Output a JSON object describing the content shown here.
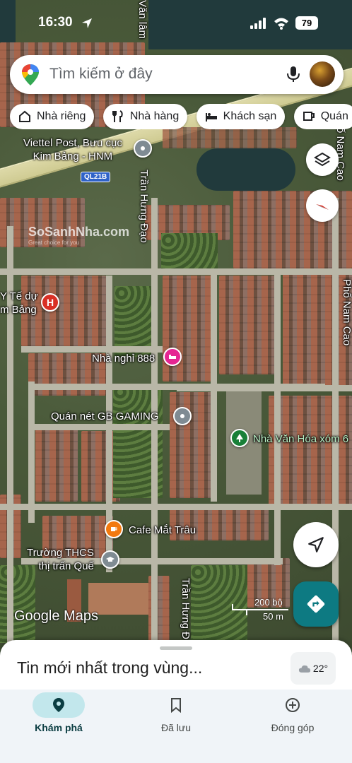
{
  "status_bar": {
    "time": "16:30",
    "battery": "79"
  },
  "search": {
    "placeholder": "Tìm kiếm ở đây"
  },
  "chips": [
    {
      "label": "Nhà riêng",
      "icon": "home-icon"
    },
    {
      "label": "Nhà hàng",
      "icon": "restaurant-icon"
    },
    {
      "label": "Khách sạn",
      "icon": "hotel-icon"
    },
    {
      "label": "Quán",
      "icon": "coffee-icon"
    }
  ],
  "map": {
    "places": {
      "post_office": "Viettel Post, Bưu cục\nKim Bảng - HNM",
      "health": "Y Tế dự\nm Bảng",
      "guesthouse": "Nhà nghỉ 888",
      "gaming": "Quán nét GB GAMING",
      "culture_house": "Nhà Văn Hóa xóm 6",
      "cafe": "Cafe Mắt Trâu",
      "school": "Trường THCS\nthị trấn Quế"
    },
    "streets": {
      "van_lam": "Văn lâm",
      "tran_hung_dao_1": "Trần Hưng Đạo",
      "tran_hung_dao_2": "Trần Hưng Đ",
      "nam_cao_1": "ố Nam Cao",
      "nam_cao_2": "Phố Nam Cao"
    },
    "route_badge": "QL21B",
    "watermark_title": "SoSanhNha.com",
    "watermark_sub": "Great choice for you",
    "attribution": "Google Maps",
    "scale": {
      "imperial": "200 bộ",
      "metric": "50 m"
    }
  },
  "sheet": {
    "title": "Tin mới nhất trong vùng...",
    "temperature": "22°"
  },
  "nav": {
    "explore": "Khám phá",
    "saved": "Đã lưu",
    "contribute": "Đóng góp"
  },
  "colors": {
    "accent_teal": "#0d7a82",
    "nav_active": "#c2e7ec",
    "pin_red": "#d93025",
    "pin_pink": "#e52592",
    "pin_gray": "#7f8b93",
    "pin_orange": "#f2790f",
    "pin_green": "#188038"
  }
}
